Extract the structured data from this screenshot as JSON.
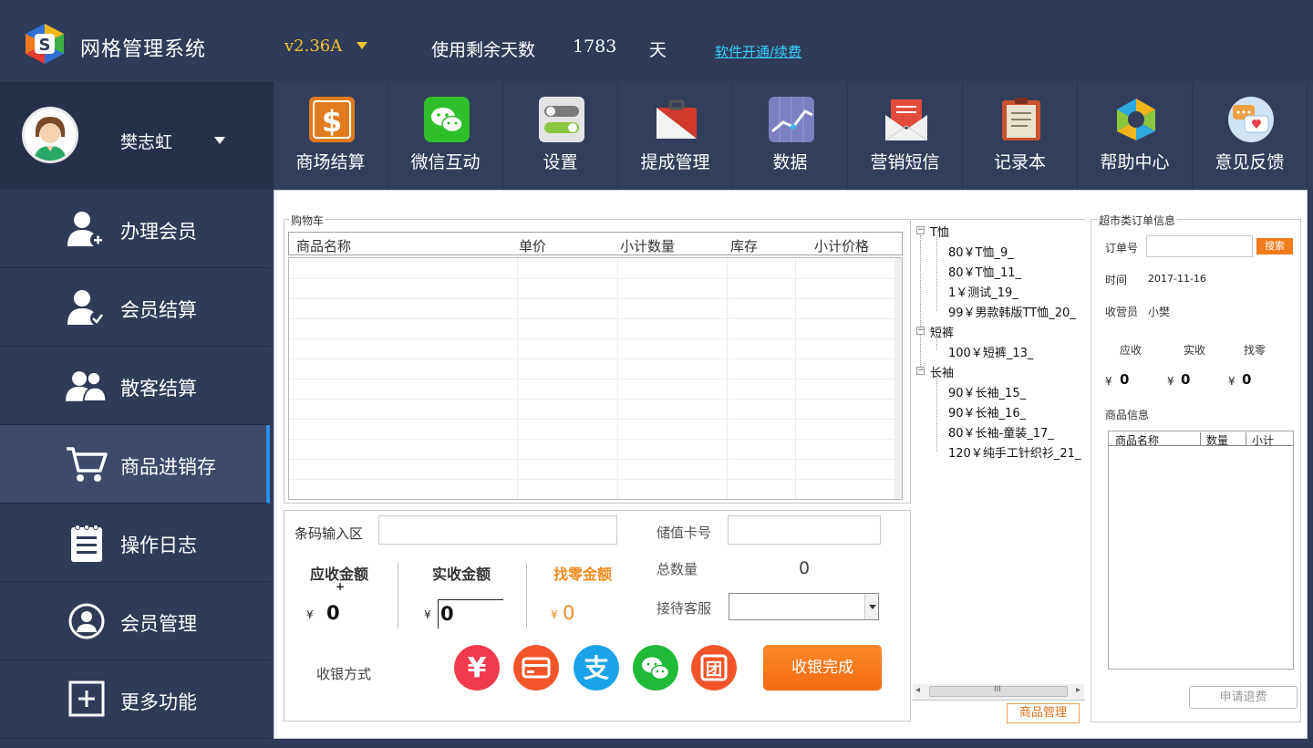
{
  "app": {
    "title": "网格管理系统",
    "version": "v2.36A",
    "days_label": "使用剩余天数",
    "days_value": "1783",
    "days_unit": "天",
    "renew_link": "软件开通/续费"
  },
  "user": {
    "name": "樊志虹"
  },
  "toolbar": [
    {
      "label": "商场结算",
      "icon": "dollar-icon",
      "color": "#e07b1f"
    },
    {
      "label": "微信互动",
      "icon": "wechat-icon",
      "color": "#2fbf2a"
    },
    {
      "label": "设置",
      "icon": "toggle-settings-icon",
      "color": "#e8e8e8"
    },
    {
      "label": "提成管理",
      "icon": "briefcase-icon",
      "color": "#d23a2e"
    },
    {
      "label": "数据",
      "icon": "chart-icon",
      "color": "#7c7fc0"
    },
    {
      "label": "营销短信",
      "icon": "envelope-icon",
      "color": "#e24b3b"
    },
    {
      "label": "记录本",
      "icon": "notebook-icon",
      "color": "#c9522f"
    },
    {
      "label": "帮助中心",
      "icon": "recycle-arrows-icon",
      "color": "#f1b51c"
    },
    {
      "label": "意见反馈",
      "icon": "chat-bubbles-icon",
      "color": "#cfe3f5"
    }
  ],
  "sidebar": [
    {
      "label": "办理会员",
      "icon": "add-user-icon"
    },
    {
      "label": "会员结算",
      "icon": "user-check-icon"
    },
    {
      "label": "散客结算",
      "icon": "users-icon"
    },
    {
      "label": "商品进销存",
      "icon": "cart-icon",
      "active": true
    },
    {
      "label": "操作日志",
      "icon": "clipboard-icon"
    },
    {
      "label": "会员管理",
      "icon": "user-circle-icon"
    },
    {
      "label": "更多功能",
      "icon": "plus-box-icon"
    }
  ],
  "cart": {
    "legend": "购物车",
    "columns": [
      "商品名称",
      "单价",
      "小计数量",
      "库存",
      "小计价格"
    ]
  },
  "checkout": {
    "barcode_label": "条码输入区",
    "card_label": "储值卡号",
    "total_qty_label": "总数量",
    "total_qty_value": "0",
    "service_label": "接待客服",
    "receivable_label": "应收金额",
    "received_label": "实收金额",
    "change_label": "找零金额",
    "receivable_mark": "+",
    "currency": "¥",
    "receivable_value": "0",
    "received_value": "0",
    "change_value": "0",
    "pay_method_label": "收银方式",
    "pay_methods": [
      {
        "icon": "cash-yen-icon",
        "glyph": "¥",
        "color": "#f23a4c"
      },
      {
        "icon": "bank-card-icon",
        "glyph": "▭",
        "color": "#f2552a"
      },
      {
        "icon": "alipay-icon",
        "glyph": "支",
        "color": "#1aa3e8"
      },
      {
        "icon": "wechat-pay-icon",
        "glyph": "◕",
        "color": "#20b938"
      },
      {
        "icon": "group-buy-icon",
        "glyph": "团",
        "color": "#f2552a"
      }
    ],
    "done_label": "收银完成"
  },
  "tree": {
    "groups": [
      {
        "label": "T恤",
        "items": [
          "80￥T恤_9_",
          "80￥T恤_11_",
          "1￥测试_19_",
          "99￥男款韩版TT恤_20_"
        ]
      },
      {
        "label": "短裤",
        "items": [
          "100￥短裤_13_"
        ]
      },
      {
        "label": "长袖",
        "items": [
          "90￥长袖_15_",
          "90￥长袖_16_",
          "80￥长袖-童装_17_",
          "120￥纯手工针织衫_21_"
        ]
      }
    ],
    "collapse_glyph": "−",
    "scroll_left": "◂",
    "scroll_right": "▸",
    "scroll_grip": "III",
    "goods_button": "商品管理"
  },
  "order": {
    "legend": "超市类订单信息",
    "order_no_label": "订单号",
    "order_no_value": "",
    "search_label": "搜索",
    "time_label": "时间",
    "time_value": "2017-11-16",
    "cashier_label": "收营员",
    "cashier_value": "小樊",
    "receivable_label": "应收",
    "received_label": "实收",
    "change_label": "找零",
    "currency": "¥",
    "receivable_value": "0",
    "received_value": "0",
    "change_value": "0",
    "goods_info_label": "商品信息",
    "goods_columns": [
      "商品名称",
      "数量",
      "小计"
    ],
    "refund_label": "申请退费"
  }
}
